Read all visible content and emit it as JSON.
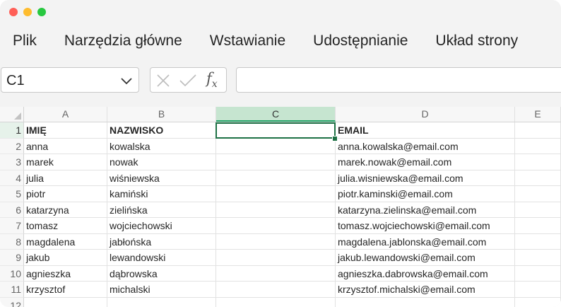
{
  "menu": [
    "Plik",
    "Narzędzia główne",
    "Wstawianie",
    "Udostępnianie",
    "Układ strony"
  ],
  "name_box": {
    "value": "C1"
  },
  "formula_bar": {
    "fx_label": "f",
    "fx_sub": "x",
    "value": ""
  },
  "columns": [
    "A",
    "B",
    "C",
    "D",
    "E"
  ],
  "selected_cell": "C1",
  "rows": [
    {
      "num": "1",
      "cells": [
        "IMIĘ",
        "NAZWISKO",
        "",
        "EMAIL",
        ""
      ],
      "header": true
    },
    {
      "num": "2",
      "cells": [
        "anna",
        "kowalska",
        "",
        "anna.kowalska@email.com",
        ""
      ]
    },
    {
      "num": "3",
      "cells": [
        "marek",
        "nowak",
        "",
        "marek.nowak@email.com",
        ""
      ]
    },
    {
      "num": "4",
      "cells": [
        "julia",
        "wiśniewska",
        "",
        "julia.wisniewska@email.com",
        ""
      ]
    },
    {
      "num": "5",
      "cells": [
        "piotr",
        "kamiński",
        "",
        "piotr.kaminski@email.com",
        ""
      ]
    },
    {
      "num": "6",
      "cells": [
        "katarzyna",
        "zielińska",
        "",
        "katarzyna.zielinska@email.com",
        ""
      ]
    },
    {
      "num": "7",
      "cells": [
        "tomasz",
        "wojciechowski",
        "",
        "tomasz.wojciechowski@email.com",
        ""
      ]
    },
    {
      "num": "8",
      "cells": [
        "magdalena",
        "jabłońska",
        "",
        "magdalena.jablonska@email.com",
        ""
      ]
    },
    {
      "num": "9",
      "cells": [
        "jakub",
        "lewandowski",
        "",
        "jakub.lewandowski@email.com",
        ""
      ]
    },
    {
      "num": "10",
      "cells": [
        "agnieszka",
        "dąbrowska",
        "",
        "agnieszka.dabrowska@email.com",
        ""
      ]
    },
    {
      "num": "11",
      "cells": [
        "krzysztof",
        "michalski",
        "",
        "krzysztof.michalski@email.com",
        ""
      ]
    },
    {
      "num": "12",
      "cells": [
        "",
        "",
        "",
        "",
        ""
      ]
    }
  ]
}
